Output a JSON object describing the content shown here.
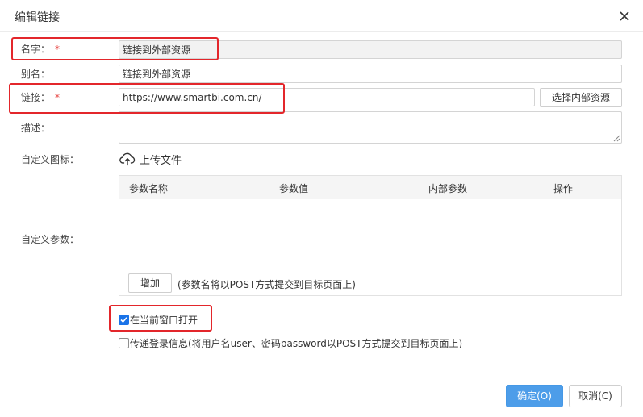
{
  "dialog": {
    "title": "编辑链接",
    "close_icon": "close-icon"
  },
  "form": {
    "name": {
      "label": "名字：",
      "required_mark": "*",
      "value": "链接到外部资源"
    },
    "alias": {
      "label": "别名：",
      "value": "链接到外部资源"
    },
    "link": {
      "label": "链接：",
      "required_mark": "*",
      "value": "https://www.smartbi.com.cn/",
      "select_button": "选择内部资源"
    },
    "description": {
      "label": "描述：",
      "value": ""
    },
    "icon": {
      "label": "自定义图标：",
      "upload_label": "上传文件",
      "upload_icon": "cloud-upload-icon"
    },
    "params": {
      "label": "自定义参数：",
      "columns": [
        "参数名称",
        "参数值",
        "内部参数",
        "操作"
      ],
      "add_button": "增加",
      "hint": "(参数名将以POST方式提交到目标页面上)"
    },
    "open_in_current_window": {
      "label": "在当前窗口打开",
      "checked": true
    },
    "pass_login_info": {
      "label": "传递登录信息(将用户名user、密码password以POST方式提交到目标页面上)",
      "checked": false
    }
  },
  "footer": {
    "ok_label": "确定(O)",
    "cancel_label": "取消(C)"
  },
  "colors": {
    "highlight": "#e3262b",
    "primary": "#4d9de9",
    "checkbox": "#1a73e8",
    "required": "#e64340"
  }
}
